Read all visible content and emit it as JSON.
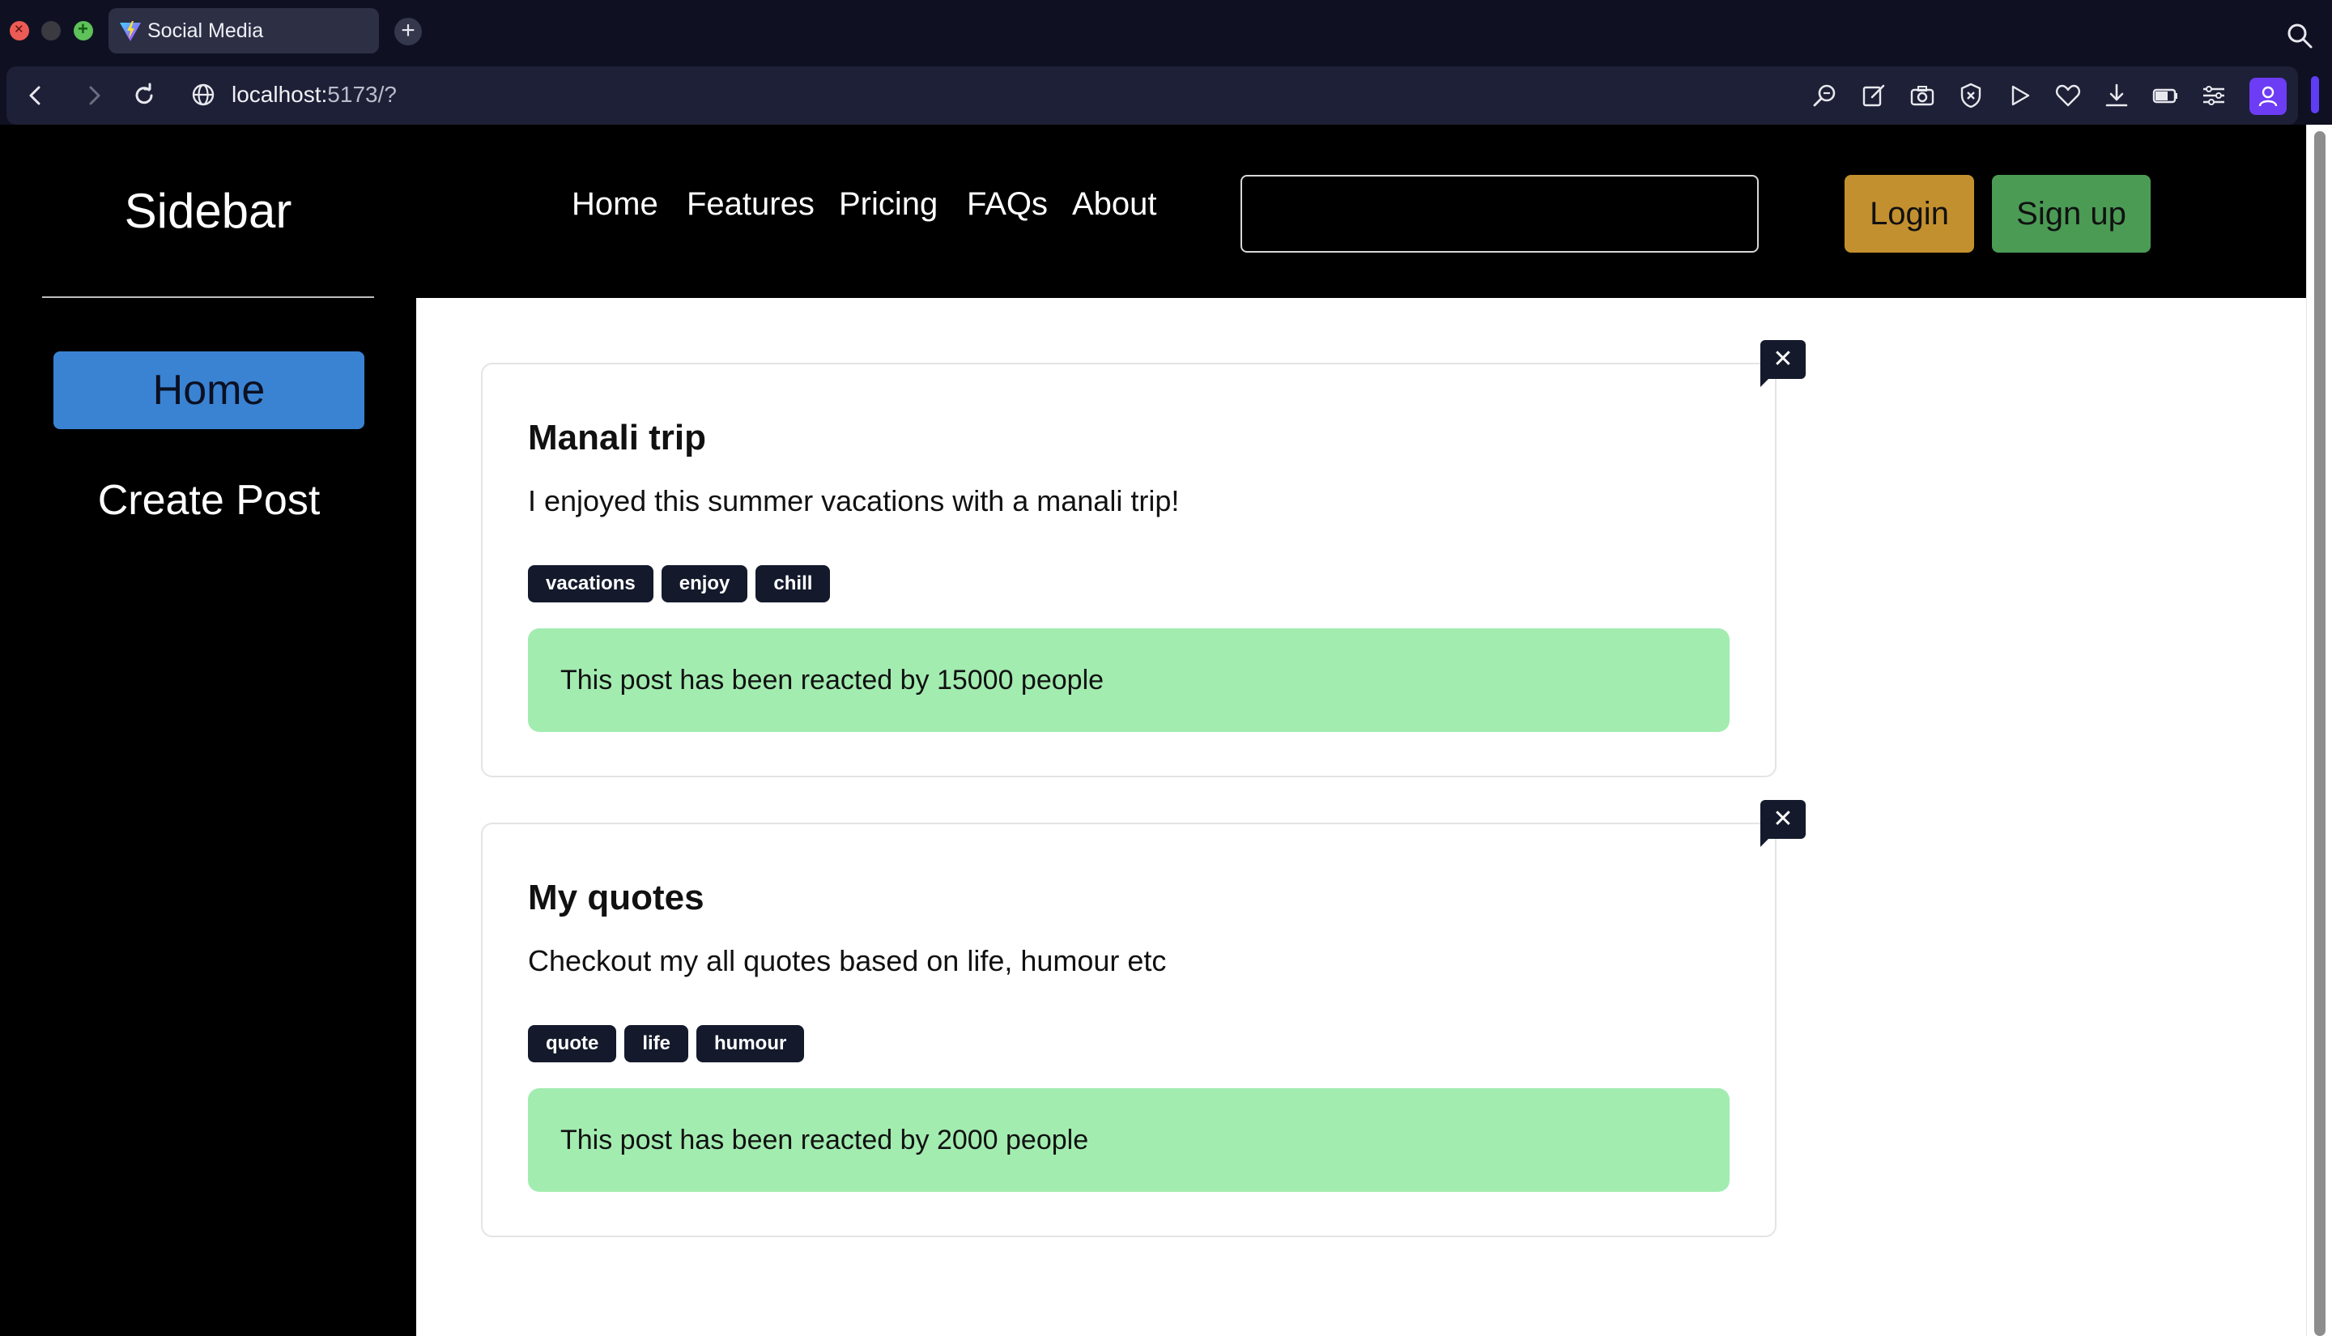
{
  "browser": {
    "tab_title": "Social Media",
    "new_tab_label": "+",
    "url_host": "localhost:",
    "url_rest": "5173/?"
  },
  "sidebar": {
    "brand": "Sidebar",
    "items": [
      {
        "label": "Home",
        "active": true
      },
      {
        "label": "Create Post",
        "active": false
      }
    ]
  },
  "header": {
    "nav": [
      "Home",
      "Features",
      "Pricing",
      "FAQs",
      "About"
    ],
    "search_value": "",
    "login_label": "Login",
    "signup_label": "Sign up"
  },
  "posts": [
    {
      "title": "Manali trip",
      "body": "I enjoyed this summer vacations with a manali trip!",
      "tags": [
        "vacations",
        "enjoy",
        "chill"
      ],
      "reactions_text": "This post has been reacted by 15000 people"
    },
    {
      "title": "My quotes",
      "body": "Checkout my all quotes based on life, humour etc",
      "tags": [
        "quote",
        "life",
        "humour"
      ],
      "reactions_text": "This post has been reacted by 2000 people"
    }
  ],
  "close_label": "✕",
  "colors": {
    "accent_blue": "#3a83d3",
    "login_gold": "#c3902f",
    "signup_green": "#4b9b55",
    "reaction_green": "#a2ecb0",
    "tag_dark": "#141a2c"
  }
}
